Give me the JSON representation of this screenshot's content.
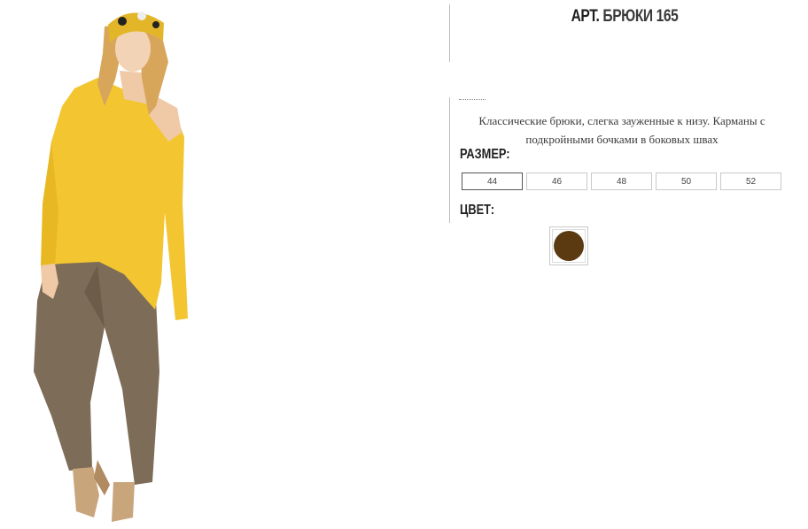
{
  "product": {
    "title_prefix": "АРТ.",
    "title_name": "БРЮКИ 165",
    "description": "Классические брюки, слегка зауженные к низу. Карманы с подкройными бочками в боковых швах",
    "size_label": "РАЗМЕР:",
    "sizes": [
      "44",
      "46",
      "48",
      "50",
      "52"
    ],
    "selected_size": "44",
    "color_label": "ЦВЕТ:",
    "colors": [
      {
        "name": "brown",
        "hex": "#5b3a12"
      }
    ]
  },
  "colors": {
    "top_yellow": "#f2c531",
    "pants_taupe": "#7d6c58",
    "swatch_brown": "#5b3a12"
  }
}
